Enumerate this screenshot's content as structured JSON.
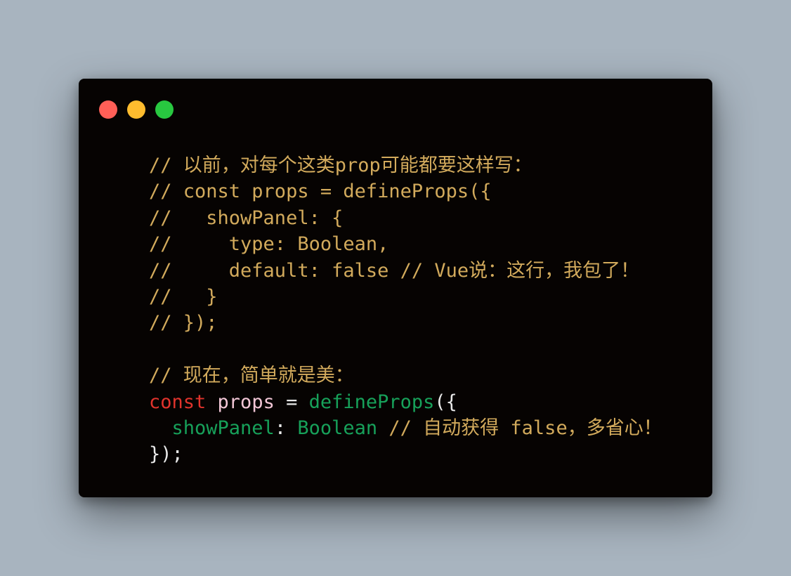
{
  "window": {
    "buttons": {
      "close": "close",
      "minimize": "minimize",
      "zoom": "zoom"
    }
  },
  "colors": {
    "background": "#a8b4bf",
    "window": "#060302",
    "comment": "#d2aa5c",
    "keyword": "#e0332c",
    "variable": "#f2c6d6",
    "function": "#17a15a",
    "punctuation": "#e8e8e8"
  },
  "code": {
    "l1": "// 以前，对每个这类prop可能都要这样写：",
    "l2": "// const props = defineProps({",
    "l3": "//   showPanel: {",
    "l4": "//     type: Boolean,",
    "l5": "//     default: false // Vue说：这行，我包了！",
    "l6": "//   }",
    "l7": "// });",
    "l9": "// 现在，简单就是美：",
    "l10": {
      "keyword": "const",
      "space1": " ",
      "variable": "props",
      "equals": " = ",
      "function": "defineProps",
      "open": "({"
    },
    "l11": {
      "indent": "  ",
      "property": "showPanel",
      "colon": ": ",
      "type": "Boolean",
      "comment": " // 自动获得 false，多省心！"
    },
    "l12": "});"
  }
}
